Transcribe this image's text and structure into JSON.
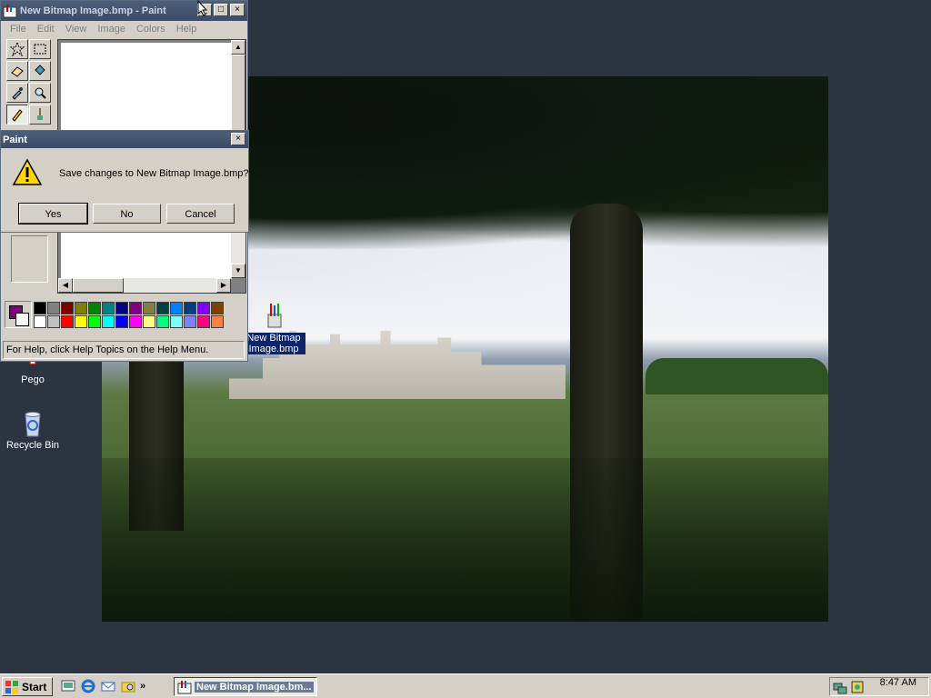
{
  "paint_window": {
    "title": "New Bitmap Image.bmp - Paint",
    "menu": [
      "File",
      "Edit",
      "View",
      "Image",
      "Colors",
      "Help"
    ],
    "status": "For Help, click Help Topics on the Help Menu."
  },
  "dialog": {
    "title": "Paint",
    "message": "Save changes to New Bitmap Image.bmp?",
    "buttons": {
      "yes": "Yes",
      "no": "No",
      "cancel": "Cancel"
    }
  },
  "palette": {
    "foreground": "#800080",
    "background": "#ffffff",
    "row1": [
      "#000000",
      "#808080",
      "#800000",
      "#808000",
      "#008000",
      "#008080",
      "#000080",
      "#800080",
      "#808040",
      "#004040",
      "#0080ff",
      "#004080",
      "#8000ff",
      "#804000"
    ],
    "row2": [
      "#ffffff",
      "#c0c0c0",
      "#ff0000",
      "#ffff00",
      "#00ff00",
      "#00ffff",
      "#0000ff",
      "#ff00ff",
      "#ffff80",
      "#00ff80",
      "#80ffff",
      "#8080ff",
      "#ff0080",
      "#ff8040"
    ]
  },
  "desktop_icons": {
    "bitmap": "New Bitmap Image.bmp",
    "pego": "Pego",
    "recycle": "Recycle Bin"
  },
  "taskbar": {
    "start": "Start",
    "task_label": "New Bitmap Image.bm...",
    "more": "»",
    "clock": "8:47 AM"
  }
}
